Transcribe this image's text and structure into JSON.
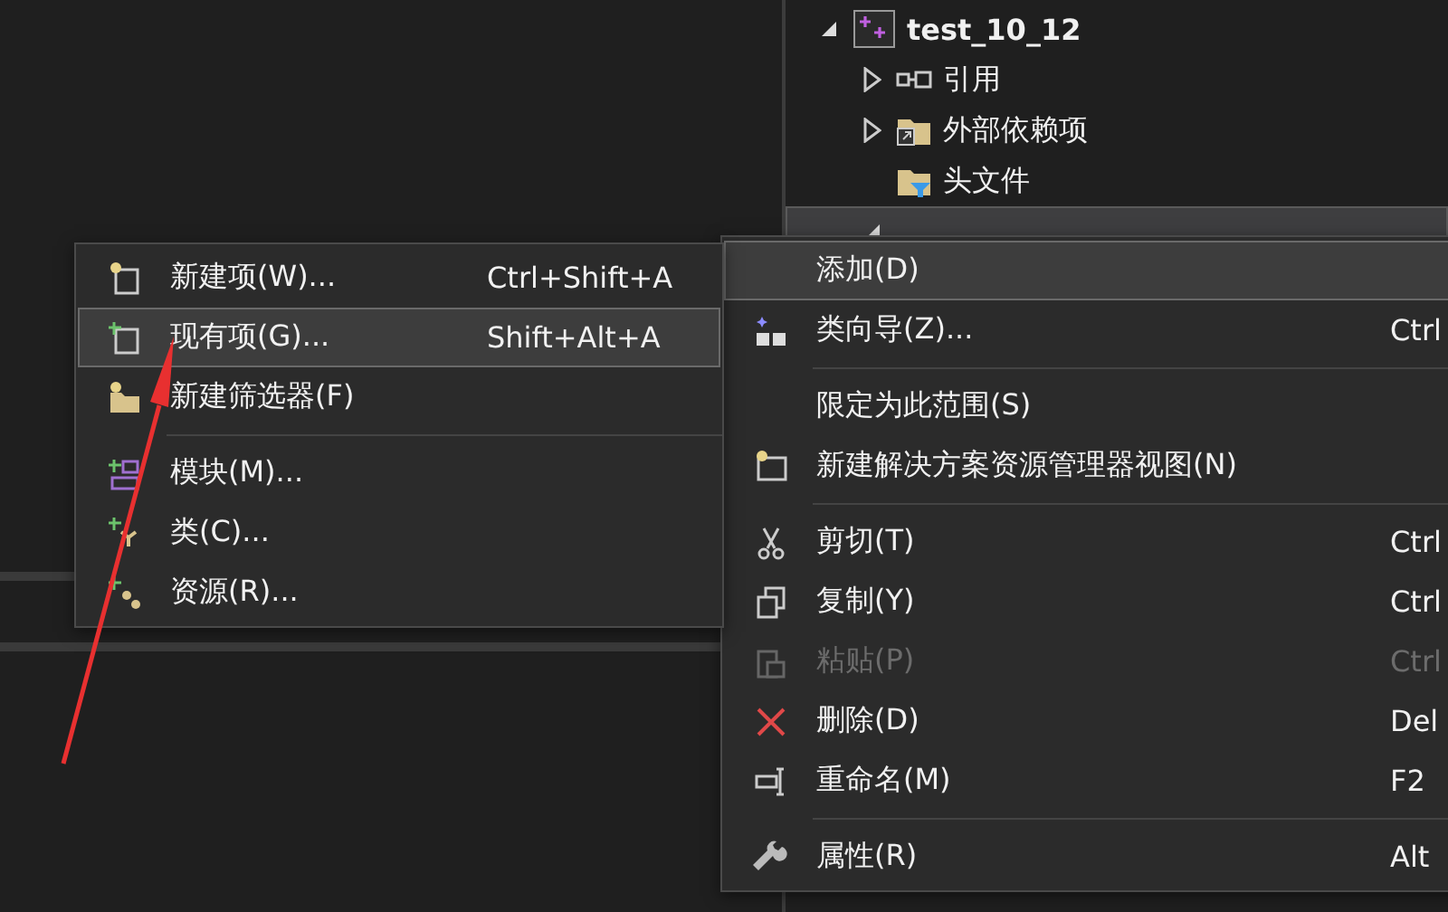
{
  "solution_explorer": {
    "project": {
      "label": "test_10_12",
      "expanded": true,
      "children": [
        {
          "label": "引用",
          "expanded": false,
          "selected": false
        },
        {
          "label": "外部依赖项",
          "expanded": false,
          "selected": false
        },
        {
          "label": "头文件",
          "selected": false
        },
        {
          "expanded": true,
          "selected": true
        }
      ]
    }
  },
  "context_menu": {
    "items": [
      {
        "kind": "item",
        "label": "添加(D)",
        "selected": true,
        "disabled": false
      },
      {
        "kind": "item",
        "label": "类向导(Z)...",
        "shortcut": "Ctrl",
        "selected": false,
        "disabled": false
      },
      {
        "kind": "separator"
      },
      {
        "kind": "item",
        "label": "限定为此范围(S)",
        "selected": false,
        "disabled": false
      },
      {
        "kind": "item",
        "label": "新建解决方案资源管理器视图(N)",
        "selected": false,
        "disabled": false
      },
      {
        "kind": "separator"
      },
      {
        "kind": "item",
        "label": "剪切(T)",
        "shortcut": "Ctrl",
        "selected": false,
        "disabled": false
      },
      {
        "kind": "item",
        "label": "复制(Y)",
        "shortcut": "Ctrl",
        "selected": false,
        "disabled": false
      },
      {
        "kind": "item",
        "label": "粘贴(P)",
        "shortcut": "Ctrl",
        "selected": false,
        "disabled": true
      },
      {
        "kind": "item",
        "label": "删除(D)",
        "shortcut": "Del",
        "selected": false,
        "disabled": false
      },
      {
        "kind": "item",
        "label": "重命名(M)",
        "shortcut": "F2",
        "selected": false,
        "disabled": false
      },
      {
        "kind": "separator"
      },
      {
        "kind": "item",
        "label": "属性(R)",
        "shortcut": "Alt",
        "selected": false,
        "disabled": false
      }
    ]
  },
  "submenu": {
    "items": [
      {
        "kind": "item",
        "label": "新建项(W)...",
        "shortcut": "Ctrl+Shift+A",
        "selected": false
      },
      {
        "kind": "item",
        "label": "现有项(G)...",
        "shortcut": "Shift+Alt+A",
        "selected": true
      },
      {
        "kind": "item",
        "label": "新建筛选器(F)",
        "selected": false
      },
      {
        "kind": "separator"
      },
      {
        "kind": "item",
        "label": "模块(M)...",
        "selected": false
      },
      {
        "kind": "item",
        "label": "类(C)...",
        "selected": false
      },
      {
        "kind": "item",
        "label": "资源(R)...",
        "selected": false
      }
    ]
  }
}
